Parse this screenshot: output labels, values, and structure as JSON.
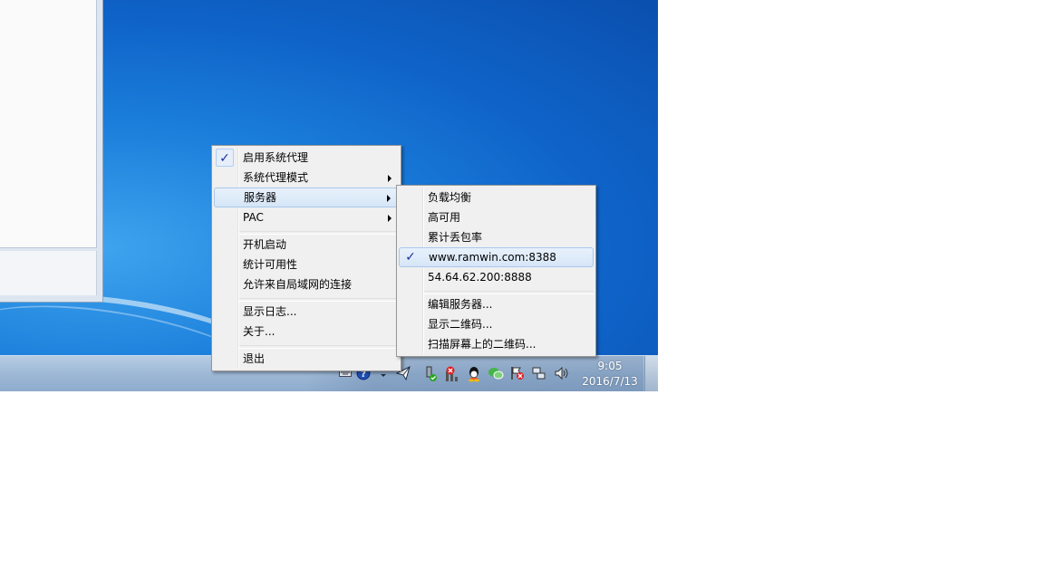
{
  "main_menu": {
    "items": [
      {
        "label": "启用系统代理",
        "checked": true
      },
      {
        "label": "系统代理模式",
        "submenu": true
      },
      {
        "label": "服务器",
        "submenu": true,
        "highlighted": true
      },
      {
        "label": "PAC",
        "submenu": true
      },
      {
        "label": "开机启动"
      },
      {
        "label": "统计可用性"
      },
      {
        "label": "允许来自局域网的连接"
      },
      {
        "label": "显示日志..."
      },
      {
        "label": "关于..."
      },
      {
        "label": "退出"
      }
    ]
  },
  "server_menu": {
    "items": [
      {
        "label": "负载均衡"
      },
      {
        "label": "高可用"
      },
      {
        "label": "累计丢包率"
      },
      {
        "label": "www.ramwin.com:8388",
        "checked": true,
        "highlighted": true
      },
      {
        "label": "54.64.62.200:8888"
      },
      {
        "label": "编辑服务器..."
      },
      {
        "label": "显示二维码..."
      },
      {
        "label": "扫描屏幕上的二维码..."
      }
    ]
  },
  "tray": {
    "icons": [
      "keyboard-icon",
      "help-icon",
      "chevron-up-icon",
      "shadowsocks-plane-icon",
      "usb-safely-remove-icon",
      "network-error-icon",
      "qq-icon",
      "wechat-icon",
      "action-center-flag-icon",
      "network-icon",
      "volume-icon"
    ]
  },
  "clock": {
    "time": "9:05",
    "date": "2016/7/13"
  },
  "colors": {
    "desktop": "#1b7fdb",
    "menu_bg": "#f0f0f0",
    "check": "#1c2fa0",
    "highlight_border": "#a8c8ec"
  }
}
